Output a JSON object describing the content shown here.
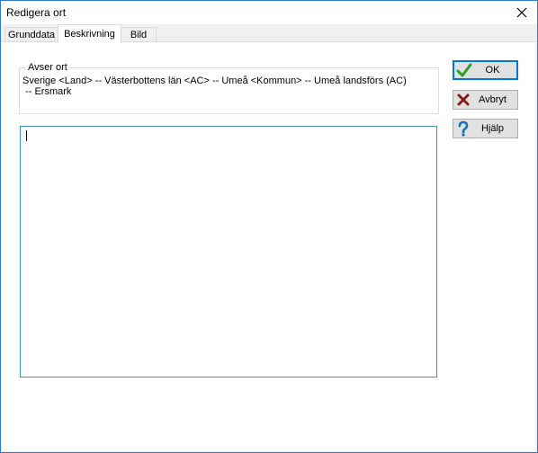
{
  "window": {
    "title": "Redigera ort"
  },
  "tabs": [
    {
      "label": "Grunddata"
    },
    {
      "label": "Beskrivning"
    },
    {
      "label": "Bild"
    }
  ],
  "group": {
    "legend": "Avser ort",
    "text": "Sverige <Land> -- Västerbottens län <AC> -- Umeå <Kommun> -- Umeå landsförs (AC)\n -- Ersmark"
  },
  "editor": {
    "value": ""
  },
  "buttons": {
    "ok": {
      "label": "OK",
      "icon": "check-icon"
    },
    "cancel": {
      "label": "Avbryt",
      "icon": "x-icon"
    },
    "help": {
      "label": "Hjälp",
      "icon": "question-icon"
    }
  },
  "colors": {
    "accent": "#0078d7",
    "ok_icon": "#2e9e2e",
    "cancel_icon": "#8b1b1b",
    "help_icon": "#1d6fb8"
  }
}
